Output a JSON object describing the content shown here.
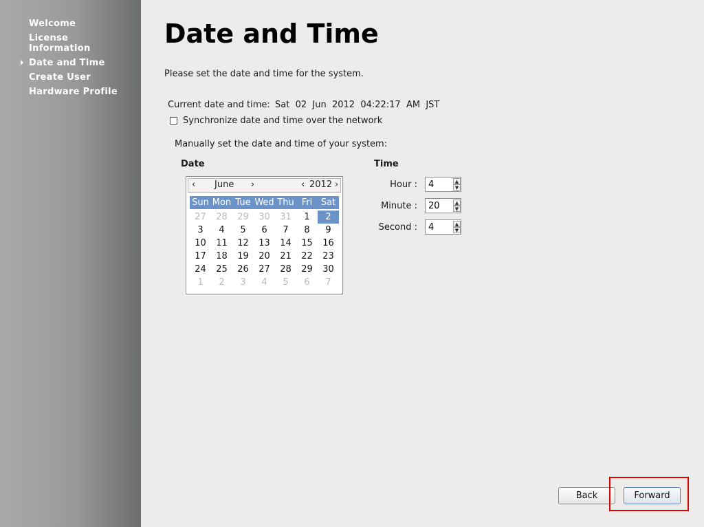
{
  "sidebar": {
    "items": [
      {
        "label": "Welcome"
      },
      {
        "label": "License\nInformation"
      },
      {
        "label": "Date and Time"
      },
      {
        "label": "Create User"
      },
      {
        "label": "Hardware Profile"
      }
    ],
    "active_index": 2
  },
  "main": {
    "title": "Date and Time",
    "intro": "Please set the date and time for the system.",
    "current_label": "Current date and time:",
    "current_value": "Sat  02  Jun  2012  04:22:17  AM  JST",
    "sync_label": "Synchronize date and time over the network",
    "sync_checked": false,
    "manual_label": "Manually set the date and time of your system:",
    "date_heading": "Date",
    "time_heading": "Time"
  },
  "calendar": {
    "month": "June",
    "year": "2012",
    "prev_month": "‹",
    "next_month": "›",
    "prev_year": "‹",
    "next_year": "›",
    "day_names": [
      "Sun",
      "Mon",
      "Tue",
      "Wed",
      "Thu",
      "Fri",
      "Sat"
    ],
    "weeks": [
      [
        "27",
        "28",
        "29",
        "30",
        "31",
        "1",
        "2"
      ],
      [
        "3",
        "4",
        "5",
        "6",
        "7",
        "8",
        "9"
      ],
      [
        "10",
        "11",
        "12",
        "13",
        "14",
        "15",
        "16"
      ],
      [
        "17",
        "18",
        "19",
        "20",
        "21",
        "22",
        "23"
      ],
      [
        "24",
        "25",
        "26",
        "27",
        "28",
        "29",
        "30"
      ],
      [
        "1",
        "2",
        "3",
        "4",
        "5",
        "6",
        "7"
      ]
    ],
    "selected_day": "2"
  },
  "time": {
    "hour_label": "Hour :",
    "hour": "4",
    "minute_label": "Minute :",
    "minute": "20",
    "second_label": "Second :",
    "second": "4"
  },
  "footer": {
    "back_label": "Back",
    "forward_label": "Forward"
  },
  "colors": {
    "selection": "#6c93c7",
    "highlight_box": "#e00000"
  },
  "icons": {
    "sidebar_marker": "arrow-right-icon",
    "spin_up": "arrow-up-icon",
    "spin_down": "arrow-down-icon"
  }
}
